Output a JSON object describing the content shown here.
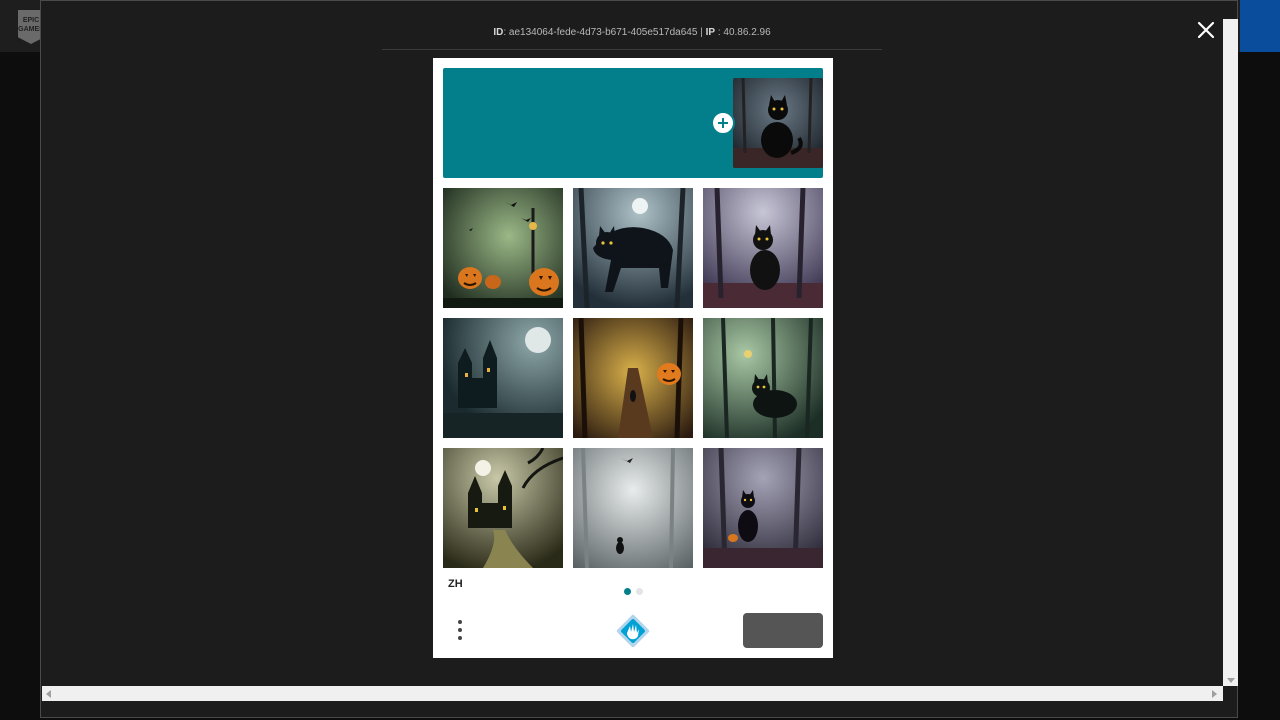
{
  "background": {
    "logo_text": "EPIC GAMES",
    "accent_color": "#0a4d9c"
  },
  "modal": {
    "close_icon": "close-icon",
    "session": {
      "id_prefix": "",
      "id_label": "ID",
      "id_value": "ae134064-fede-4d73-b671-405e517da645",
      "separator": "|",
      "ip_label": "IP",
      "ip_suffix": "",
      "ip_value": "40.86.2.96"
    }
  },
  "captcha": {
    "banner_color": "#037f8c",
    "banner_title": "",
    "banner_subtitle": "",
    "sample_image": "black-cat",
    "tiles": [
      {
        "subject": "pumpkins"
      },
      {
        "subject": "black-cat-moon"
      },
      {
        "subject": "black-cat-sitting"
      },
      {
        "subject": "castle-moon"
      },
      {
        "subject": "pumpkin-path"
      },
      {
        "subject": "black-cat-green"
      },
      {
        "subject": "castle-tree"
      },
      {
        "subject": "cat-fog"
      },
      {
        "subject": "black-cat-pumpkin"
      }
    ],
    "language": "ZH",
    "pager": {
      "active": 1,
      "total": 2,
      "active_color": "#037f8c"
    },
    "submit_label": "",
    "logo_icon": "hcaptcha-icon",
    "menu_icon": "more-vertical-icon"
  }
}
